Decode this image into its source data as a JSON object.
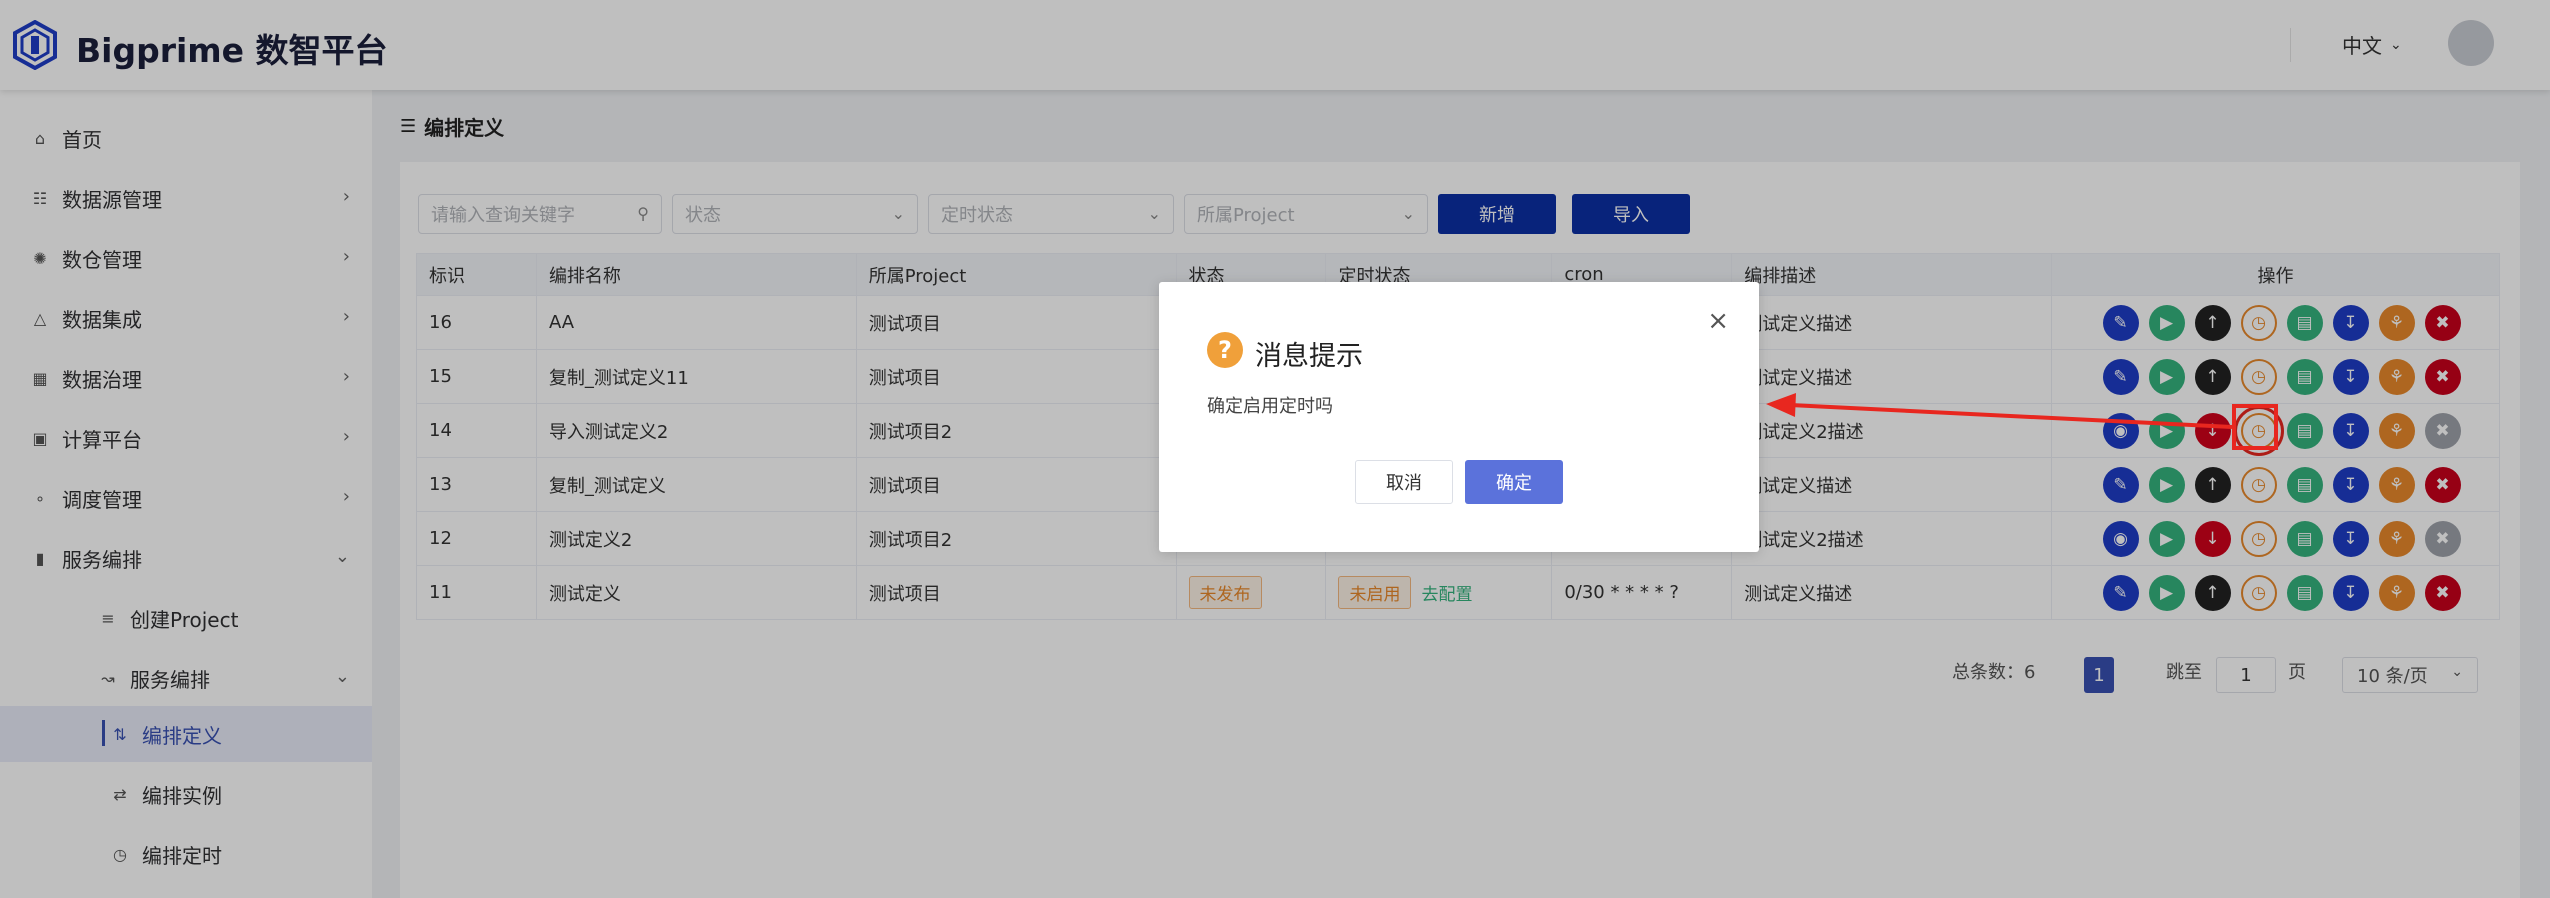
{
  "header": {
    "app_title": "Bigprime 数智平台",
    "language": "中文",
    "logo_icon": "hexagon-logo-icon",
    "avatar_icon": "user-avatar"
  },
  "sidebar": {
    "items": [
      {
        "label": "首页",
        "icon": "home-icon"
      },
      {
        "label": "数据源管理",
        "icon": "datasource-icon"
      },
      {
        "label": "数仓管理",
        "icon": "warehouse-icon"
      },
      {
        "label": "数据集成",
        "icon": "integration-icon"
      },
      {
        "label": "数据治理",
        "icon": "governance-icon"
      },
      {
        "label": "计算平台",
        "icon": "compute-icon"
      },
      {
        "label": "调度管理",
        "icon": "schedule-icon"
      },
      {
        "label": "服务编排",
        "icon": "chart-icon"
      }
    ],
    "sub_items": [
      {
        "label": "创建Project",
        "icon": "list-icon"
      },
      {
        "label": "服务编排",
        "icon": "line-chart-icon"
      }
    ],
    "sub2_items": [
      {
        "label": "编排定义",
        "icon": "sort-icon",
        "active": true
      },
      {
        "label": "编排实例",
        "icon": "swap-icon"
      },
      {
        "label": "编排定时",
        "icon": "clock-icon"
      }
    ]
  },
  "page": {
    "title": "编排定义"
  },
  "filters": {
    "search_placeholder": "请输入查询关键字",
    "status_placeholder": "状态",
    "timing_status_placeholder": "定时状态",
    "project_placeholder": "所属Project",
    "add_label": "新增",
    "import_label": "导入"
  },
  "table": {
    "columns": [
      "标识",
      "编排名称",
      "所属Project",
      "状态",
      "定时状态",
      "cron",
      "编排描述",
      "操作"
    ],
    "rows": [
      {
        "id": "16",
        "name": "AA",
        "project": "测试项目",
        "desc": "测试定义描述"
      },
      {
        "id": "15",
        "name": "复制_测试定义11",
        "project": "测试项目",
        "desc": "测试定义描述"
      },
      {
        "id": "14",
        "name": "导入测试定义2",
        "project": "测试项目2",
        "desc": "测试定义2描述"
      },
      {
        "id": "13",
        "name": "复制_测试定义",
        "project": "测试项目",
        "desc": "测试定义描述"
      },
      {
        "id": "12",
        "name": "测试定义2",
        "project": "测试项目2",
        "desc": "测试定义2描述"
      },
      {
        "id": "11",
        "name": "测试定义",
        "project": "测试项目",
        "status": "未发布",
        "timing": "未启用",
        "timing_link": "去配置",
        "cron": "0/30 * * * * ?",
        "desc": "测试定义描述"
      }
    ]
  },
  "pagination": {
    "total": "总条数：6",
    "current": "1",
    "jump": "跳至",
    "jump_value": "1",
    "page_unit": "页",
    "page_size": "10 条/页"
  },
  "dialog": {
    "title": "消息提示",
    "message": "确定启用定时吗",
    "cancel": "取消",
    "confirm": "确定",
    "icon": "question-icon"
  },
  "colors": {
    "primary": "#0b2fa4",
    "accent": "#3951b2",
    "annotation": "#e8271f"
  }
}
